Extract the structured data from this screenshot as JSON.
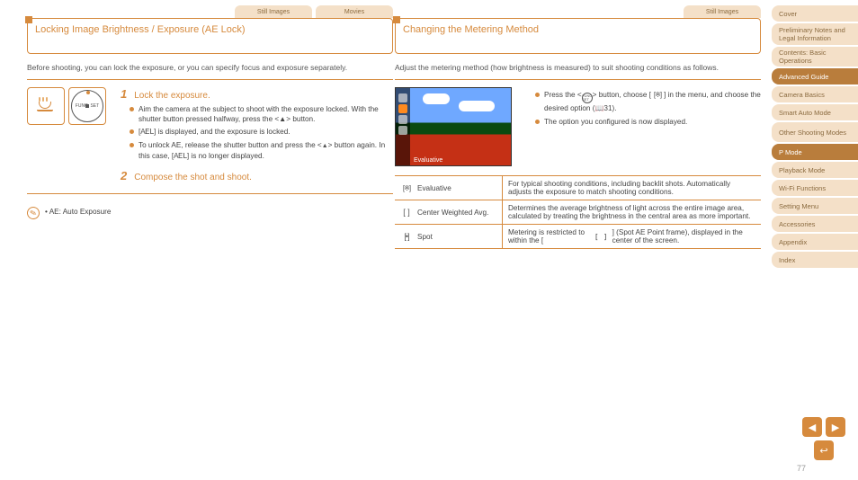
{
  "sidebar": {
    "items": [
      {
        "label": "Cover"
      },
      {
        "label": "Preliminary Notes and Legal Information"
      },
      {
        "label": "Contents: Basic Operations"
      },
      {
        "label": "Advanced Guide"
      },
      {
        "label": "Camera Basics"
      },
      {
        "label": "Smart Auto Mode"
      },
      {
        "label": "Other Shooting Modes"
      },
      {
        "label": "P Mode"
      },
      {
        "label": "Playback Mode"
      },
      {
        "label": "Wi-Fi Functions"
      },
      {
        "label": "Setting Menu"
      },
      {
        "label": "Accessories"
      },
      {
        "label": "Appendix"
      },
      {
        "label": "Index"
      }
    ]
  },
  "tabs": {
    "left": [
      {
        "label": "Still Images"
      },
      {
        "label": "Movies"
      }
    ],
    "right": [
      {
        "label": "Still Images"
      }
    ]
  },
  "left": {
    "title": "Locking Image Brightness / Exposure (AE Lock)",
    "desc": "Before shooting, you can lock the exposure, or you can specify focus and exposure separately.",
    "illus": {
      "cup_alt": "macro-icon",
      "wheel_label": "FUNC. SET"
    },
    "step1": {
      "num": "1",
      "title": "Lock the exposure.",
      "b1": "Aim the camera at the subject to shoot with the exposure locked. With the shutter button pressed halfway, press the <▲> button.",
      "b2_a": "[",
      "b2_b": "] is displayed, and the exposure is locked.",
      "b3_a": "To unlock AE, release the shutter button and press the <",
      "b3_b": "> button again. In this case, [",
      "b3_c": "] is no longer displayed."
    },
    "step2": {
      "num": "2",
      "title": "Compose the shot and shoot."
    },
    "note": "AE: Auto Exposure",
    "ael": "AEL"
  },
  "right": {
    "title": "Changing the Metering Method",
    "desc": "Adjust the metering method (how brightness is measured) to suit shooting conditions as follows.",
    "shot": {
      "label": "Evaluative"
    },
    "b1_a": "Press the <",
    "b1_b": "> button, choose [",
    "b1_c": "] in the menu, and choose the desired option (",
    "b1_d": "31).",
    "b2": "The option you configured is now displayed.",
    "page_ref": "31",
    "table": [
      {
        "icon": "bracket-star-icon",
        "name": "Evaluative",
        "desc": "For typical shooting conditions, including backlit shots. Automatically adjusts the exposure to match shooting conditions."
      },
      {
        "icon": "bracket-icon",
        "name": "Center Weighted Avg.",
        "desc": "Determines the average brightness of light across the entire image area, calculated by treating the brightness in the central area as more important."
      },
      {
        "icon": "bracket-dot-icon",
        "name": "Spot",
        "desc_a": "Metering is restricted to within the [",
        "desc_b": "] (Spot AE Point frame), displayed in the center of the screen."
      }
    ]
  },
  "page_number": "77",
  "nav": {
    "prev": "◀",
    "next": "▶",
    "back": "↩"
  }
}
